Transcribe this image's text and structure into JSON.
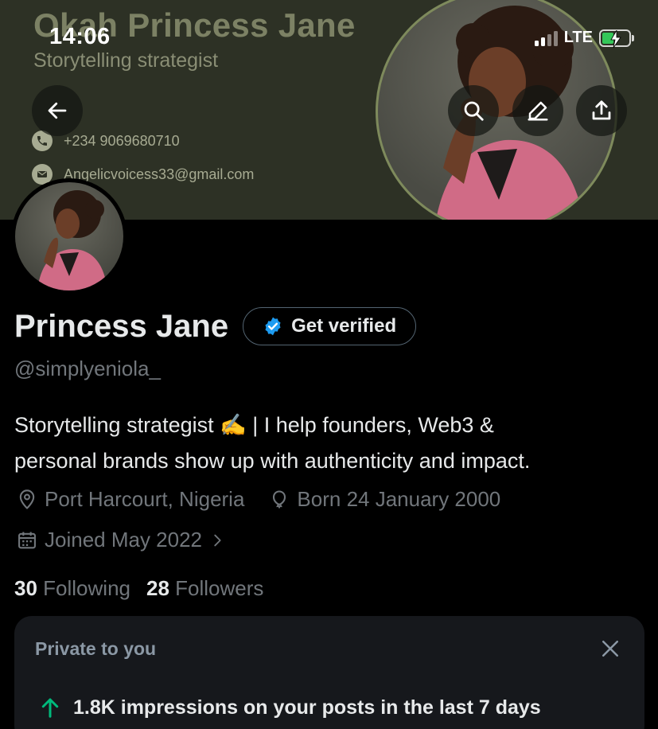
{
  "status_bar": {
    "time": "14:06",
    "network": "LTE"
  },
  "banner": {
    "name": "Okah Princess Jane",
    "subtitle": "Storytelling strategist",
    "phone": "+234 9069680710",
    "email": "Angelicvoicess33@gmail.com"
  },
  "header_actions": [
    "back-icon",
    "search-icon",
    "edit-icon",
    "share-icon"
  ],
  "profile": {
    "display_name": "Princess Jane",
    "verify_label": "Get verified",
    "handle": "@simplyeniola_",
    "bio_line1": "Storytelling strategist ✍️ | I help founders, Web3 &",
    "bio_line2": "personal brands show up with authenticity and impact.",
    "location": "Port Harcourt, Nigeria",
    "birthday": "Born 24 January 2000",
    "joined": "Joined May 2022",
    "following_count": "30",
    "following_label": "Following",
    "followers_count": "28",
    "followers_label": "Followers"
  },
  "private_card": {
    "title": "Private to you",
    "stat": "1.8K impressions on your posts in the last 7 days"
  },
  "colors": {
    "background": "#000000",
    "banner": "#2d3125",
    "muted_text": "#71767b",
    "verified_blue": "#1d9bf0",
    "up_arrow_green": "#00ba7c",
    "card_bg": "#16181c"
  }
}
